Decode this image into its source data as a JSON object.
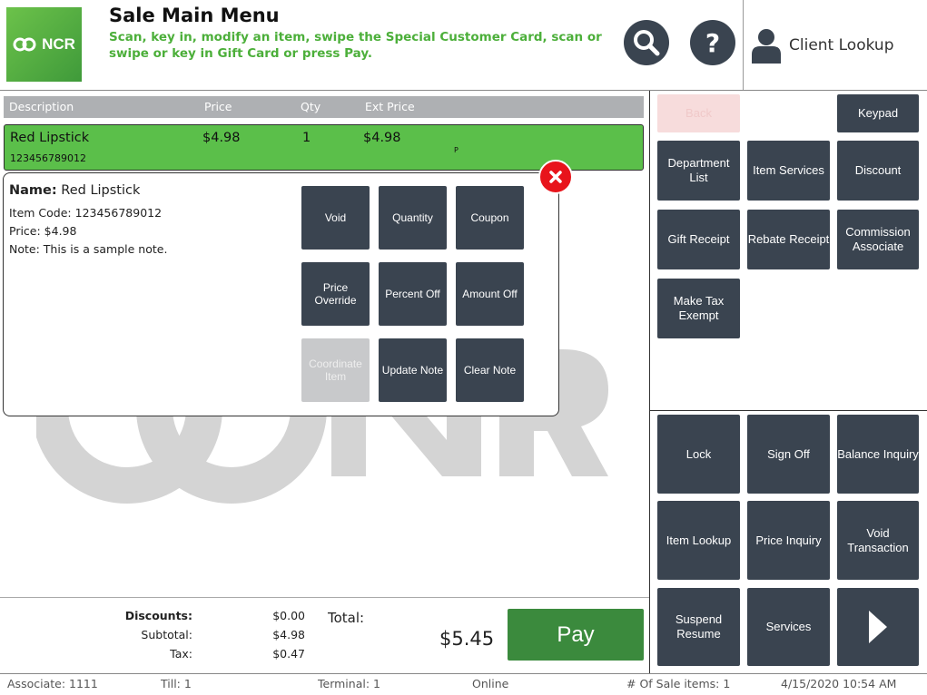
{
  "header": {
    "logo_text": "NCR",
    "title": "Sale Main Menu",
    "subtitle": "Scan, key in, modify an item, swipe the Special Customer Card, scan or swipe or key in Gift Card or press Pay.",
    "client_lookup": "Client Lookup"
  },
  "grid": {
    "columns": [
      "Description",
      "Price",
      "Qty",
      "Ext Price"
    ],
    "rows": [
      {
        "description": "Red Lipstick",
        "price": "$4.98",
        "qty": "1",
        "ext_price": "$4.98",
        "code": "123456789012",
        "flag": "P"
      }
    ]
  },
  "popup": {
    "name_label": "Name:",
    "name_value": "Red Lipstick",
    "item_code": "Item Code: 123456789012",
    "price": "Price: $4.98",
    "note": "Note: This is a sample note.",
    "buttons": [
      "Void",
      "Quantity",
      "Coupon",
      "Price Override",
      "Percent Off",
      "Amount Off",
      "Coordinate Item",
      "Update Note",
      "Clear Note"
    ]
  },
  "right_panel": {
    "top": {
      "back": "Back",
      "keypad": "Keypad",
      "buttons": [
        "Department List",
        "Item Services",
        "Discount",
        "Gift Receipt",
        "Rebate Receipt",
        "Commission Associate",
        "Make Tax Exempt"
      ]
    },
    "bottom": [
      "Lock",
      "Sign Off",
      "Balance Inquiry",
      "Item Lookup",
      "Price Inquiry",
      "Void Transaction",
      "Suspend Resume",
      "Services"
    ]
  },
  "totals": {
    "discounts_label": "Discounts:",
    "discounts": "$0.00",
    "subtotal_label": "Subtotal:",
    "subtotal": "$4.98",
    "tax_label": "Tax:",
    "tax": "$0.47",
    "total_label": "Total:",
    "total": "$5.45",
    "pay": "Pay"
  },
  "status": {
    "associate": "Associate: 1111",
    "till": "Till: 1",
    "terminal": "Terminal: 1",
    "online": "Online",
    "items": "# Of Sale items: 1",
    "datetime": "4/15/2020 10:54 AM"
  },
  "colors": {
    "accent_green": "#5bbf4a",
    "button_dark": "#3a4450",
    "pay_green": "#3b8a3d",
    "close_red": "#e8141b"
  }
}
